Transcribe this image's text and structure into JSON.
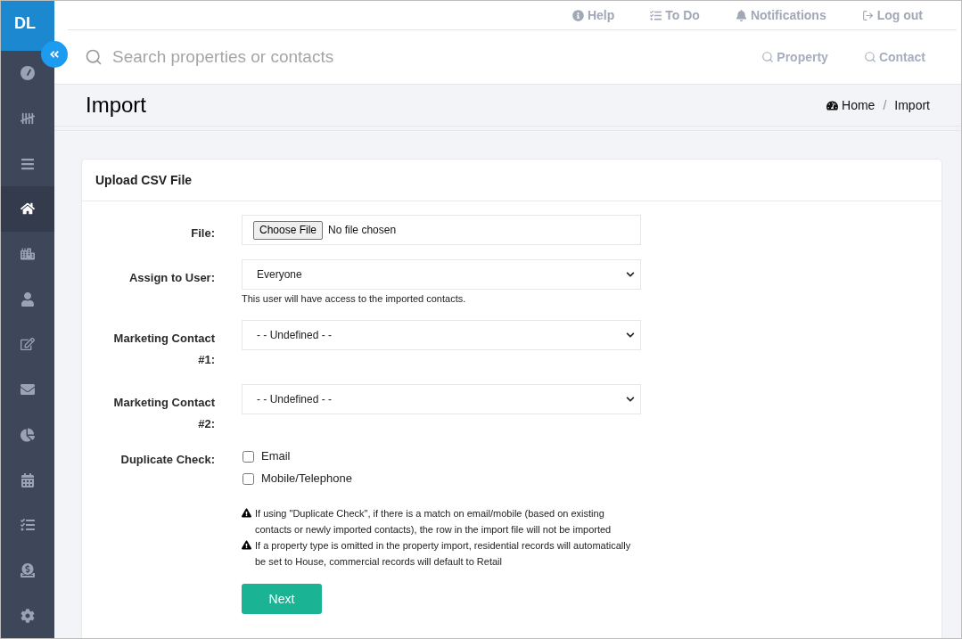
{
  "sidebar": {
    "logo": "DL",
    "items": [
      {
        "selected": false
      },
      {
        "selected": false
      },
      {
        "selected": false
      },
      {
        "selected": true
      },
      {
        "selected": false
      },
      {
        "selected": false
      },
      {
        "selected": false
      },
      {
        "selected": false
      },
      {
        "selected": false
      },
      {
        "selected": false
      },
      {
        "selected": false
      },
      {
        "selected": false
      },
      {
        "selected": false
      }
    ]
  },
  "top_links": [
    "Help",
    "To Do",
    "Notifications",
    "Log out"
  ],
  "search": {
    "placeholder": "Search properties or contacts",
    "scopes": [
      "Property",
      "Contact"
    ]
  },
  "page_header": {
    "title": "Import",
    "breadcrumb": [
      "Home",
      "Import"
    ],
    "separator": "/"
  },
  "card": {
    "title": "Upload CSV File",
    "fields": [
      {
        "kind": "file",
        "label": "File:",
        "button": "Choose File",
        "value": "No file chosen"
      },
      {
        "kind": "select",
        "label": "Assign to User:",
        "value": "Everyone",
        "help": "This user will have access to the imported contacts."
      },
      {
        "kind": "select",
        "label": "Marketing Contact #1:",
        "value": "- - Undefined - -"
      },
      {
        "kind": "select",
        "label": "Marketing Contact #2:",
        "value": "- - Undefined - -"
      },
      {
        "kind": "checkboxes",
        "label": "Duplicate Check:",
        "options": [
          {
            "label": "Email",
            "checked": false
          },
          {
            "label": "Mobile/Telephone",
            "checked": false
          }
        ]
      }
    ],
    "notes": [
      "If using \"Duplicate Check\", if there is a match on email/mobile (based on existing contacts or newly imported contacts), the row in the import file will not be imported",
      "If a property type is omitted in the property import, residential records will automatically be set to House, commercial records will default to Retail"
    ],
    "submit": "Next"
  }
}
